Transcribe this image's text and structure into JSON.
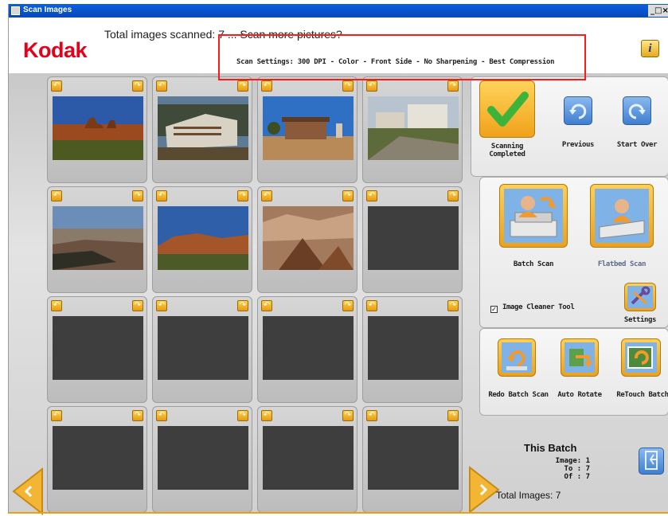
{
  "window": {
    "title": "Scan Images",
    "controls": "_□×"
  },
  "header": {
    "logo": "Kodak",
    "title": "Total images scanned: 7 ... Scan more pictures?",
    "settings": "Scan Settings: 300 DPI - Color - Front Side - No Sharpening - Best Compression",
    "info_label": "i"
  },
  "grid": {
    "rotate_left_glyph": "↶",
    "rotate_right_glyph": "↷",
    "filled_slots": 7,
    "total_slots": 16
  },
  "actions": {
    "scanning_completed": "Scanning Completed",
    "previous": "Previous",
    "start_over": "Start Over",
    "batch_scan": "Batch Scan",
    "flatbed_scan": "Flatbed Scan",
    "image_cleaner": "Image Cleaner Tool",
    "image_cleaner_checked": true,
    "settings": "Settings",
    "redo_batch_scan": "Redo Batch Scan",
    "auto_rotate": "Auto Rotate",
    "retouch_batch": "ReTouch Batch"
  },
  "batch": {
    "title": "This Batch",
    "image_label": "Image:",
    "image_value": "1",
    "to_label": "To :",
    "to_value": "7",
    "of_label": "Of :",
    "of_value": "7",
    "total_label": "Total Images: 7"
  },
  "colors": {
    "accent": "#e9a312",
    "brand_red": "#e3001b",
    "highlight_box": "#ff1a1a",
    "window_title": "#0848b8"
  }
}
